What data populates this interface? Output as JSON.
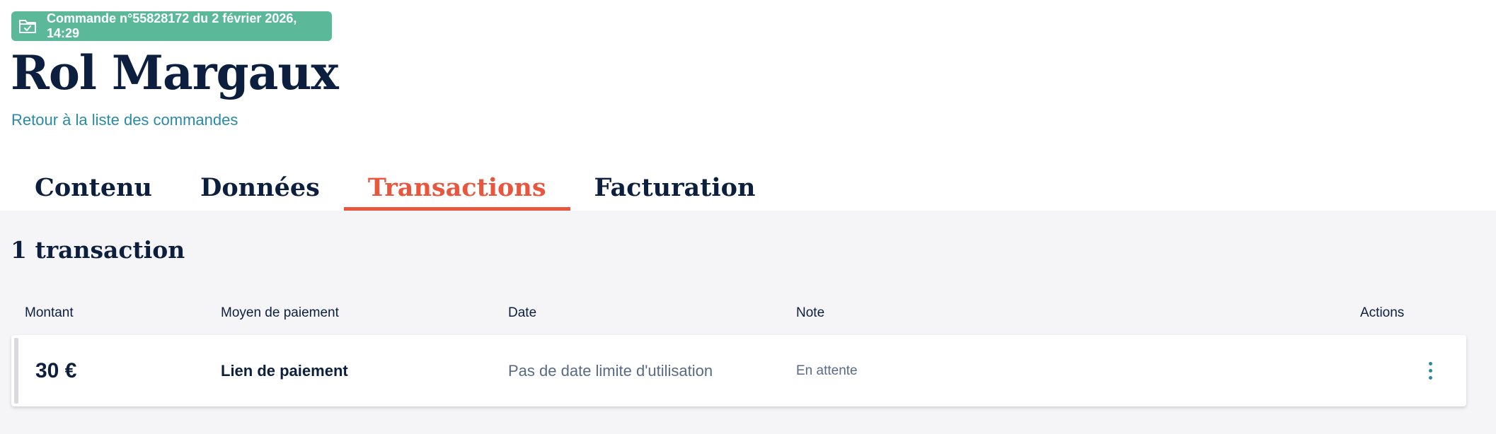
{
  "order": {
    "badge_text": "Commande n°55828172 du 2 février 2026, 14:29",
    "badge_icon": "folder-check-icon",
    "customer_name": "Rol Margaux",
    "back_link": "Retour à la liste des commandes"
  },
  "tabs": [
    {
      "label": "Contenu",
      "active": false
    },
    {
      "label": "Données",
      "active": false
    },
    {
      "label": "Transactions",
      "active": true
    },
    {
      "label": "Facturation",
      "active": false
    }
  ],
  "transactions": {
    "count_label": "1 transaction",
    "columns": [
      "Montant",
      "Moyen de paiement",
      "Date",
      "Note",
      "Actions"
    ],
    "rows": [
      {
        "amount": "30 €",
        "method": "Lien de paiement",
        "date": "Pas de date limite d'utilisation",
        "note": "En attente",
        "actions_icon": "more-vertical-icon"
      }
    ]
  },
  "colors": {
    "badge": "#5bb99a",
    "accent": "#e7563d",
    "link": "#2a8aa6",
    "text": "#0d1f3f",
    "background": "#f5f4f7"
  }
}
